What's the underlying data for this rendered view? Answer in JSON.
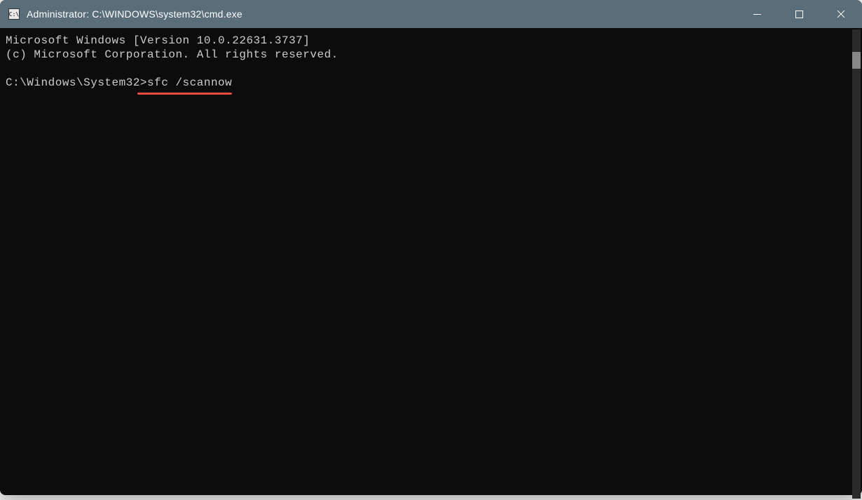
{
  "titlebar": {
    "icon_label": "C:\\",
    "title": "Administrator: C:\\WINDOWS\\system32\\cmd.exe"
  },
  "terminal": {
    "line1": "Microsoft Windows [Version 10.0.22631.3737]",
    "line2": "(c) Microsoft Corporation. All rights reserved.",
    "prompt": "C:\\Windows\\System32>",
    "command": "sfc /scannow"
  },
  "annotation": {
    "underline_color": "#e74c3c"
  }
}
